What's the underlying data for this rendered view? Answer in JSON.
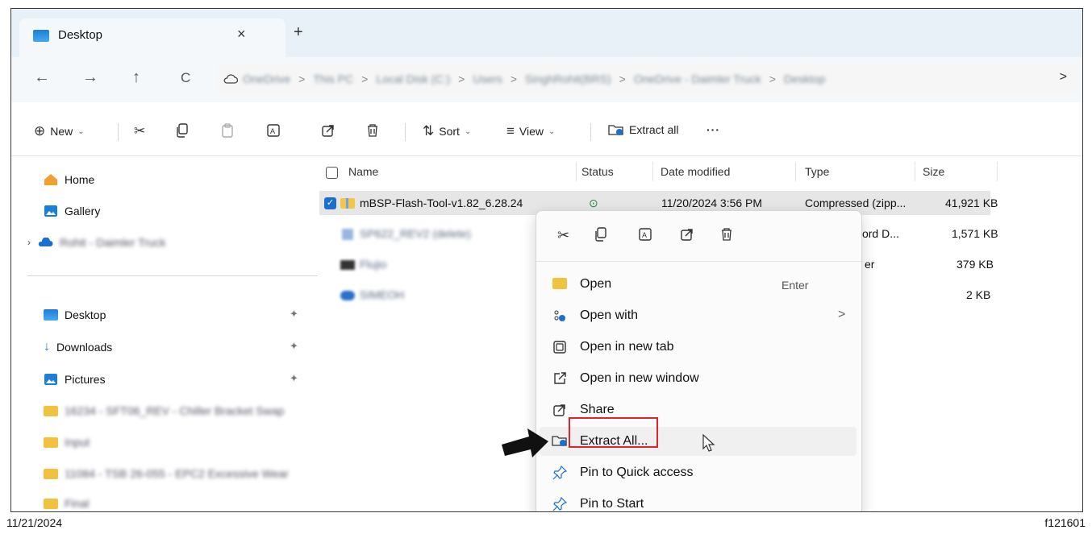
{
  "tab": {
    "title": "Desktop",
    "close": "×",
    "new_tab": "+"
  },
  "nav": {
    "back": "←",
    "forward": "→",
    "up": "↑",
    "refresh": "C",
    "breadcrumbs": [
      "OneDrive",
      "This PC",
      "Local Disk (C:)",
      "Users",
      "SinghRohit(BRS)",
      "OneDrive - Daimler Truck",
      "Desktop"
    ],
    "separator": ">",
    "more": ">"
  },
  "toolbar": {
    "new_label": "New",
    "sort_label": "Sort",
    "view_label": "View",
    "extract_all_label": "Extract all",
    "more_label": "···"
  },
  "sidebar": {
    "home": "Home",
    "gallery": "Gallery",
    "onedrive": "Rohit - Daimler Truck",
    "desktop": "Desktop",
    "downloads": "Downloads",
    "pictures": "Pictures",
    "folders": [
      "16234 - SFT06_REV - Chiller Bracket Swap",
      "Input",
      "11084 - TSB 26-055 - EPC2 Excessive Wear",
      "Final"
    ]
  },
  "columns": [
    "Name",
    "Status",
    "Date modified",
    "Type",
    "Size"
  ],
  "files": [
    {
      "name": "mBSP-Flash-Tool-v1.82_6.28.24",
      "status": "⊙",
      "date": "11/20/2024 3:56 PM",
      "type": "Compressed (zipp...",
      "size": "41,921 KB"
    },
    {
      "name": "SP622_REV2 (delete)",
      "type": "Word D...",
      "size": "1,571 KB"
    },
    {
      "name": "Flujio",
      "type": "er",
      "size": "379 KB"
    },
    {
      "name": "SIMEOH",
      "size": "2 KB"
    }
  ],
  "context_menu": {
    "items": [
      {
        "label": "Open",
        "shortcut": "Enter"
      },
      {
        "label": "Open with",
        "arrow": ">"
      },
      {
        "label": "Open in new tab"
      },
      {
        "label": "Open in new window"
      },
      {
        "label": "Share"
      },
      {
        "label": "Extract All..."
      },
      {
        "label": "Pin to Quick access"
      },
      {
        "label": "Pin to Start"
      }
    ]
  },
  "footer": {
    "date": "11/21/2024",
    "figure": "f121601"
  }
}
